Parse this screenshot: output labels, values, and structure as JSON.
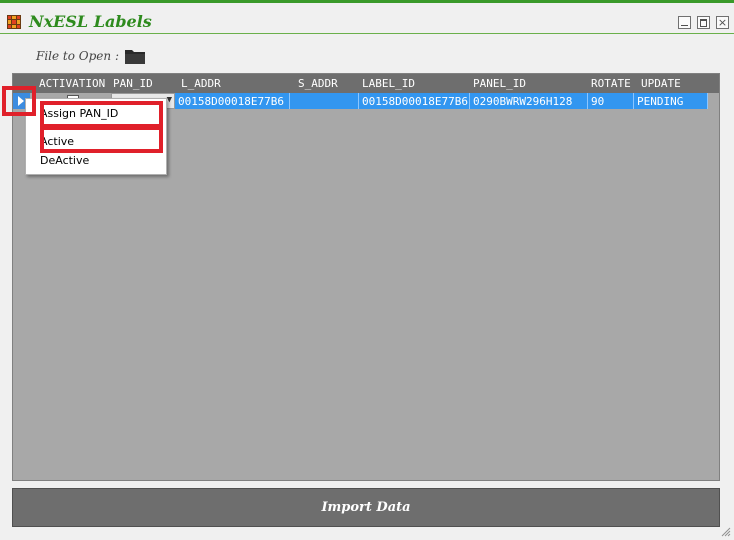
{
  "window": {
    "title": "NxESL Labels",
    "close_glyph": "×",
    "accent_color": "#3a9a2a"
  },
  "file_row": {
    "label": "File to Open :",
    "icon": "folder-icon"
  },
  "grid": {
    "columns": [
      "ACTIVATION",
      "PAN_ID",
      "L_ADDR",
      "S_ADDR",
      "LABEL_ID",
      "PANEL_ID",
      "ROTATE",
      "UPDATE"
    ],
    "rows": [
      {
        "activation_checked": false,
        "pan_id": "",
        "l_addr": "00158D00018E77B6",
        "s_addr": "",
        "label_id": "00158D00018E77B6",
        "panel_id": "0290BWRW296H128",
        "rotate": "90",
        "update": "PENDING"
      }
    ],
    "dropdown_arrow": "▼",
    "selection_color": "#3296f0"
  },
  "context_menu": {
    "items": [
      "Assign PAN_ID",
      "Active",
      "DeActive"
    ]
  },
  "import_button": {
    "label": "Import Data"
  },
  "highlight_color": "#e0202a"
}
